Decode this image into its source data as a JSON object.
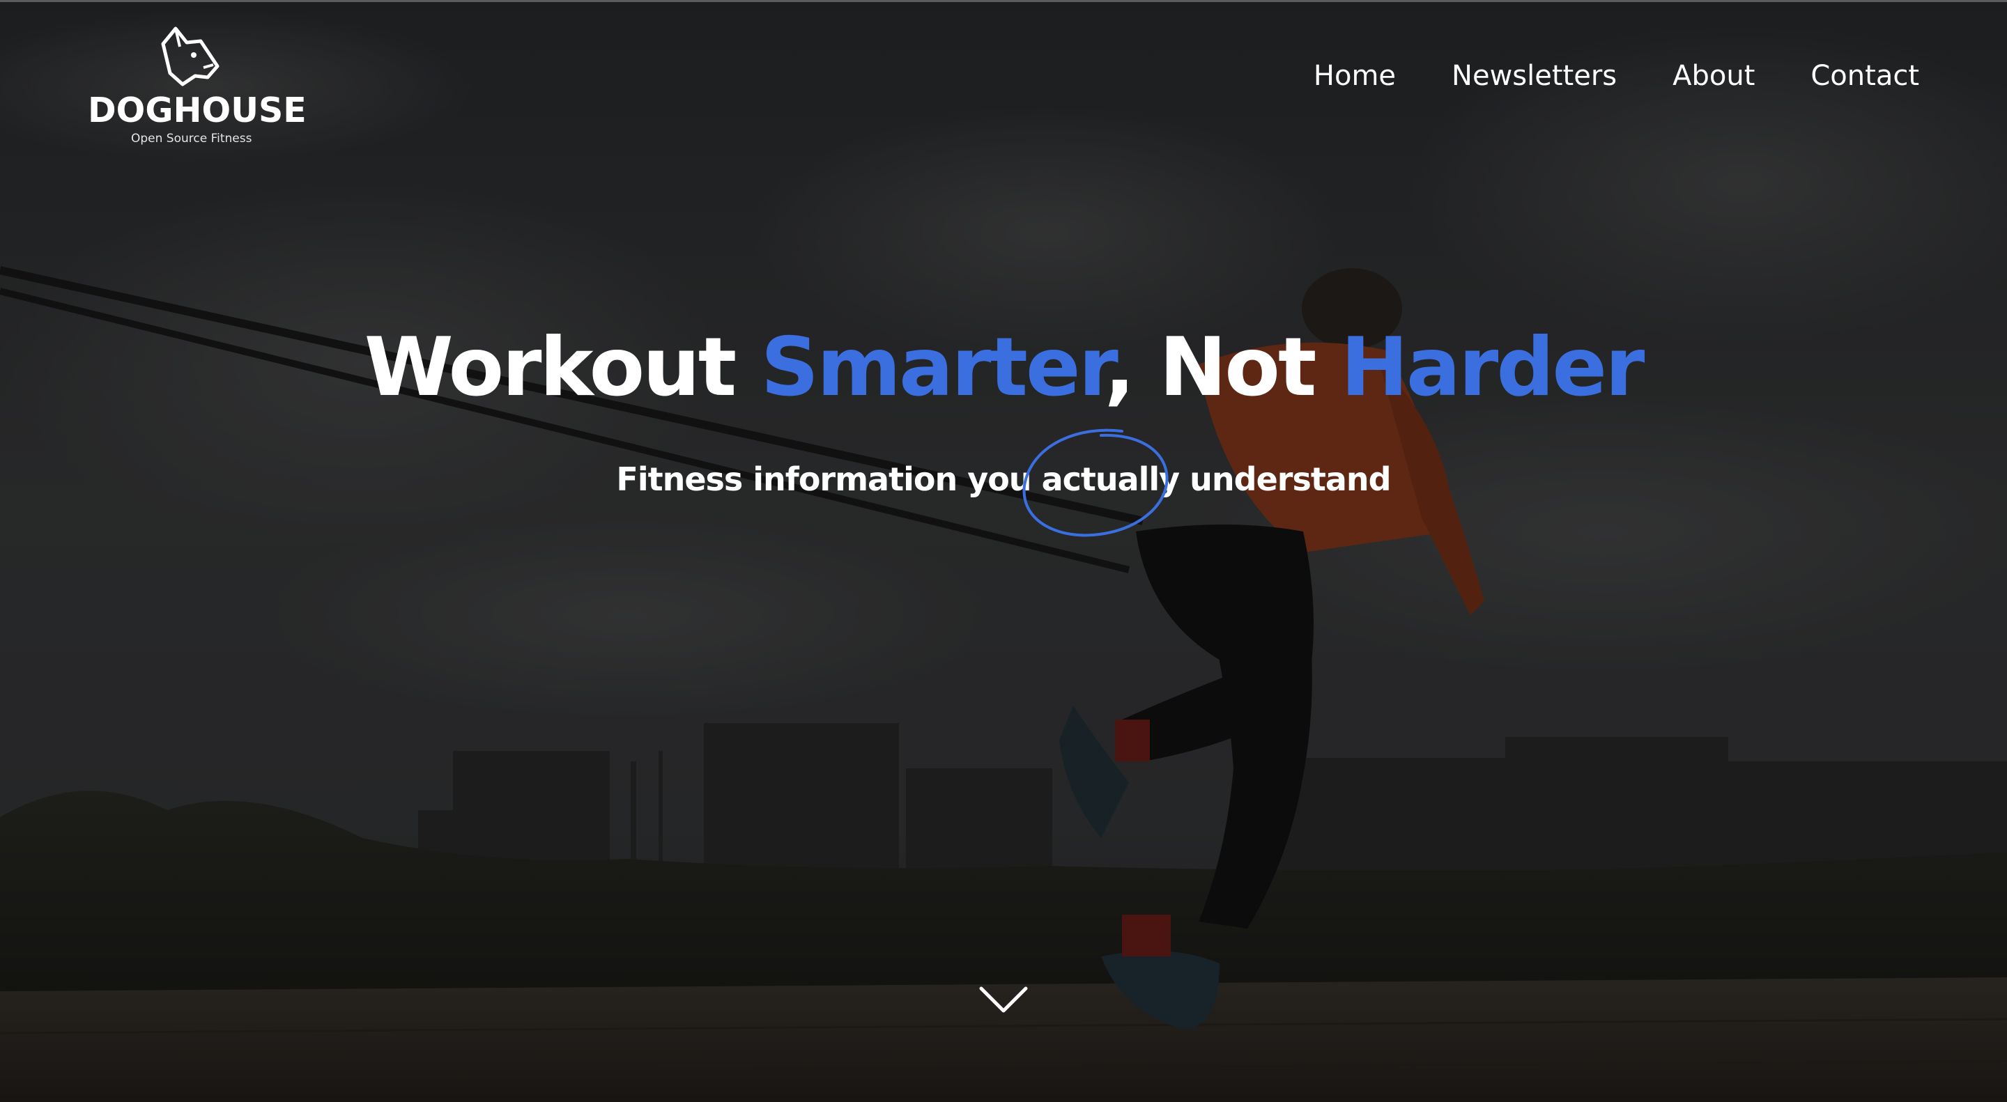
{
  "header": {
    "logo": {
      "name": "DOGHOUSE",
      "tagline": "Open Source Fitness"
    },
    "nav": [
      {
        "label": "Home"
      },
      {
        "label": "Newsletters"
      },
      {
        "label": "About"
      },
      {
        "label": "Contact"
      }
    ]
  },
  "hero": {
    "headline": {
      "part1": "Workout ",
      "accent1": "Smarter",
      "part2": ", Not ",
      "accent2": "Harder"
    },
    "subline": {
      "before": "Fitness information you ",
      "circled": "actually",
      "after": " understand"
    },
    "scroll_icon": "chevron-down-icon"
  },
  "colors": {
    "accent": "#3b6fe0",
    "text": "#ffffff",
    "overlay": "#1b1c1e"
  }
}
